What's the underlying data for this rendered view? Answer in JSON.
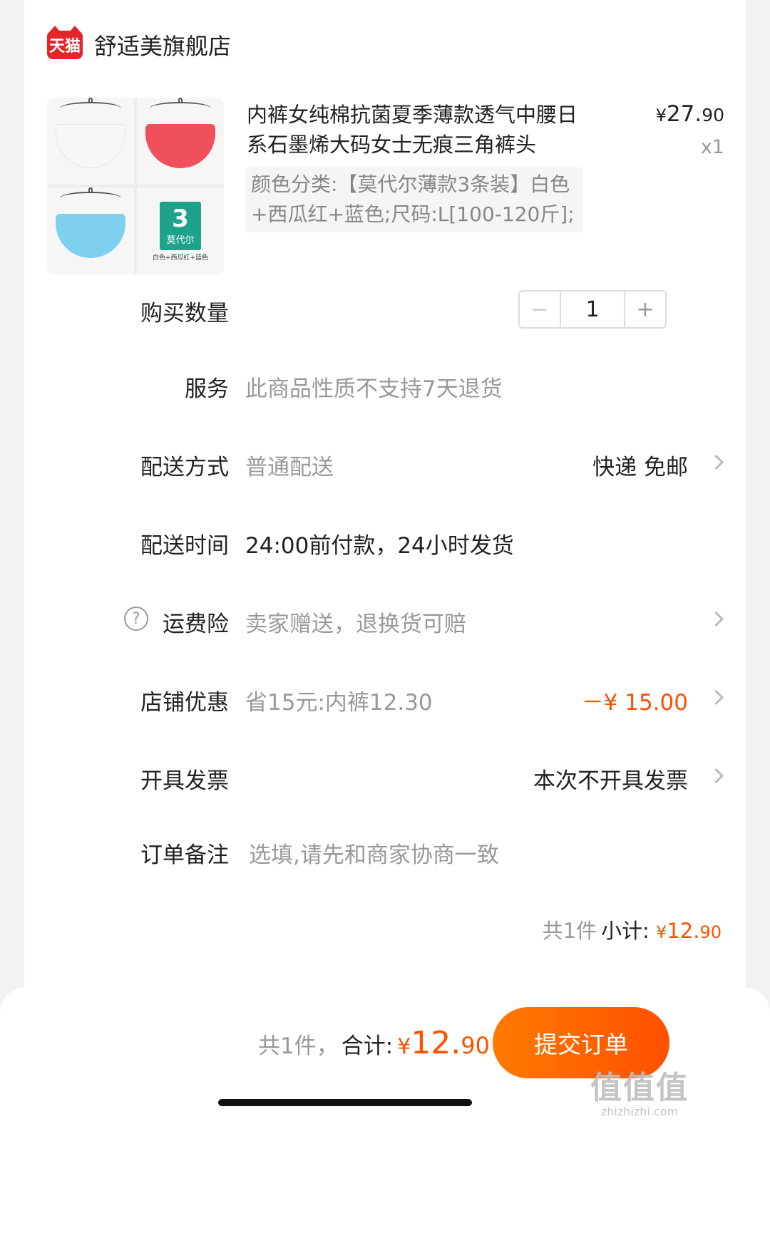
{
  "store": {
    "badge": "天猫",
    "name": "舒适美旗舰店"
  },
  "product": {
    "title": "内裤女纯棉抗菌夏季薄款透气中腰日系石墨烯大码女士无痕三角裤头",
    "price_yen": "¥",
    "price_int": "27.",
    "price_dec": "90",
    "qty": "x1",
    "sku": "颜色分类:【莫代尔薄款3条装】白色+西瓜红+蓝色;尺码:L[100-120斤];",
    "thumb": {
      "pack_num": "3",
      "pack_sub": "莫代尔",
      "pack_caption": "白色+西瓜红+蓝色"
    },
    "swatch_colors": [
      "#f7f7f7",
      "#f04f5c",
      "#7fd0ee"
    ]
  },
  "quantity": {
    "label": "购买数量",
    "minus": "−",
    "value": "1",
    "plus": "+"
  },
  "service": {
    "label": "服务",
    "value": "此商品性质不支持7天退货"
  },
  "delivery": {
    "label": "配送方式",
    "value": "普通配送",
    "right": "快递 免邮"
  },
  "delivery_time": {
    "label": "配送时间",
    "value": "24:00前付款，24小时发货"
  },
  "shipping_insurance": {
    "label": "运费险",
    "help": "?",
    "value": "卖家赠送，退换货可赔"
  },
  "store_discount": {
    "label": "店铺优惠",
    "value": "省15元:内裤12.30",
    "amount": "－¥ 15.00"
  },
  "invoice": {
    "label": "开具发票",
    "right": "本次不开具发票"
  },
  "order_note": {
    "label": "订单备注",
    "placeholder": "选填,请先和商家协商一致"
  },
  "subtotal": {
    "count": "共1件",
    "label": "小计:",
    "yen": "¥",
    "int": "12.",
    "dec": "90"
  },
  "footer": {
    "count": "共1件，",
    "label": "合计:",
    "yen": "¥",
    "int": "12.",
    "dec": "90",
    "submit": "提交订单"
  },
  "watermark": {
    "main": "值值值",
    "sub": "zhizhizhi.com"
  },
  "colors": {
    "accent": "#ff5000",
    "tmall_red": "#e4262a"
  }
}
